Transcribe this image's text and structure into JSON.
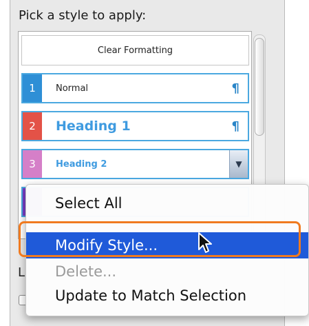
{
  "panel": {
    "title": "Pick a style to apply:"
  },
  "styles": [
    {
      "label": "Clear Formatting",
      "number": "",
      "color": ""
    },
    {
      "label": "Normal",
      "number": "1",
      "color": "#2e8fd6"
    },
    {
      "label": "Heading 1",
      "number": "2",
      "color": "#e35247"
    },
    {
      "label": "Heading 2",
      "number": "3",
      "color": "#d57fc8"
    }
  ],
  "background_fragments": {
    "list_label_initial": "L"
  },
  "context_menu": {
    "items": [
      {
        "label": "Select All",
        "state": "normal"
      },
      {
        "label": "Modify Style...",
        "state": "selected"
      },
      {
        "label": "Delete...",
        "state": "disabled"
      },
      {
        "label": "Update to Match Selection",
        "state": "normal"
      }
    ]
  },
  "icons": {
    "pilcrow": "¶",
    "dropdown_arrow": "▼"
  },
  "colors": {
    "accent_blue": "#4aa8e0",
    "heading_blue": "#3f9be0",
    "menu_selection": "#1f5ad9",
    "highlight_ring": "#f07a1f"
  }
}
